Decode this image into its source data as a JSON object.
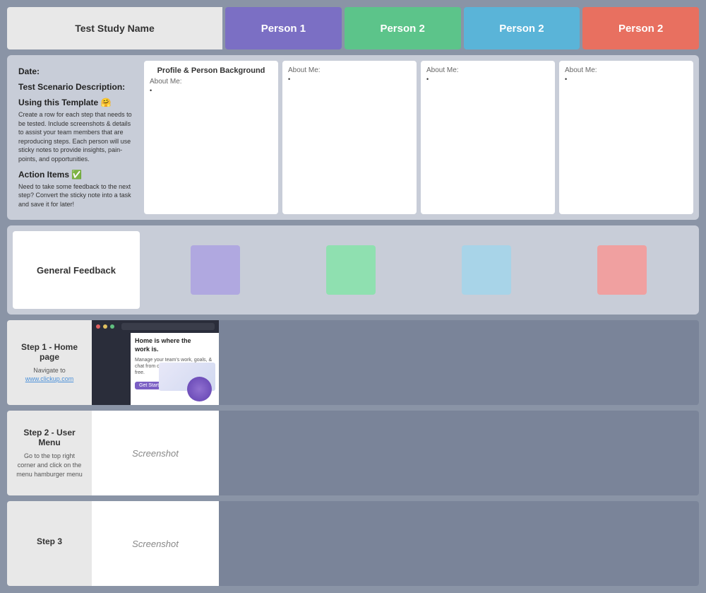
{
  "header": {
    "title": "Test Study Name",
    "persons": [
      {
        "label": "Person 1",
        "color_class": "person1"
      },
      {
        "label": "Person 2",
        "color_class": "person2-green"
      },
      {
        "label": "Person 2",
        "color_class": "person2-blue"
      },
      {
        "label": "Person 2",
        "color_class": "person2-red"
      }
    ]
  },
  "about_section": {
    "date_label": "Date:",
    "scenario_label": "Test Scenario Description:",
    "using_label": "Using this Template 🤗",
    "using_text": "Create a row for each step that needs to be tested. Include screenshots & details to assist your team members that are reproducing steps. Each person will use sticky notes to provide insights, pain-points, and opportunities.",
    "action_label": "Action Items ✅",
    "action_text": "Need to take some feedback to the next step? Convert the sticky note into a task and save it for later!",
    "profile_header": "Profile & Person Background",
    "cards": [
      {
        "about_me": "About Me:",
        "text": "•"
      },
      {
        "about_me": "About Me:",
        "text": "•"
      },
      {
        "about_me": "About Me:",
        "text": "•"
      },
      {
        "about_me": "About Me:",
        "text": "•"
      }
    ]
  },
  "feedback_section": {
    "label": "General Feedback",
    "stickies": [
      {
        "color_class": "sticky-purple"
      },
      {
        "color_class": "sticky-green"
      },
      {
        "color_class": "sticky-lightblue"
      },
      {
        "color_class": "sticky-pink"
      }
    ]
  },
  "steps": [
    {
      "title": "Step 1 - Home page",
      "desc": "Navigate to",
      "link_text": "www.clickup.com",
      "has_screenshot": true,
      "screenshot_label": ""
    },
    {
      "title": "Step 2 - User Menu",
      "desc": "Go to the top right corner and click on the menu hamburger menu",
      "has_screenshot": false,
      "screenshot_label": "Screenshot"
    },
    {
      "title": "Step 3",
      "desc": "",
      "has_screenshot": false,
      "screenshot_label": "Screenshot"
    }
  ]
}
